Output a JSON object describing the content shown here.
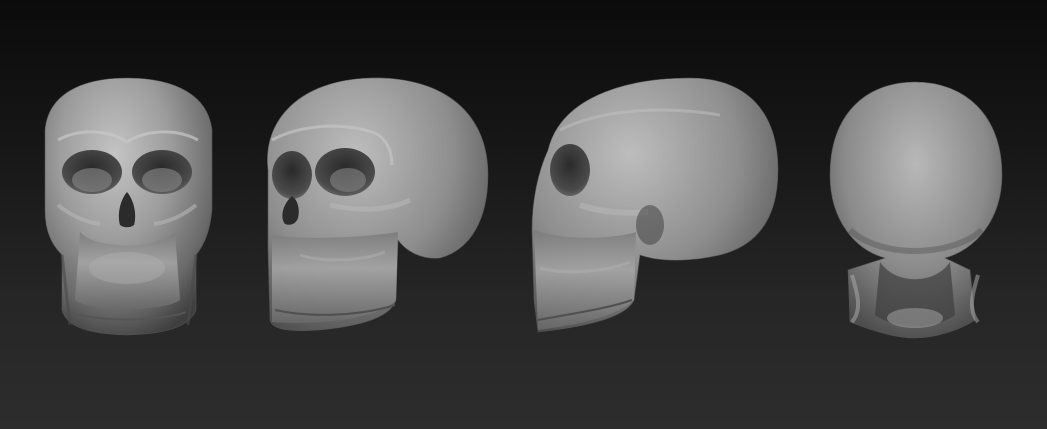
{
  "viewport": {
    "background_top": "#0b0b0b",
    "background_bottom": "#2d2d2d",
    "material_color": "#9a9a9a"
  },
  "views": [
    {
      "name": "front",
      "subject": "skull"
    },
    {
      "name": "three-quarter",
      "subject": "skull"
    },
    {
      "name": "side",
      "subject": "skull"
    },
    {
      "name": "back",
      "subject": "skull"
    }
  ]
}
